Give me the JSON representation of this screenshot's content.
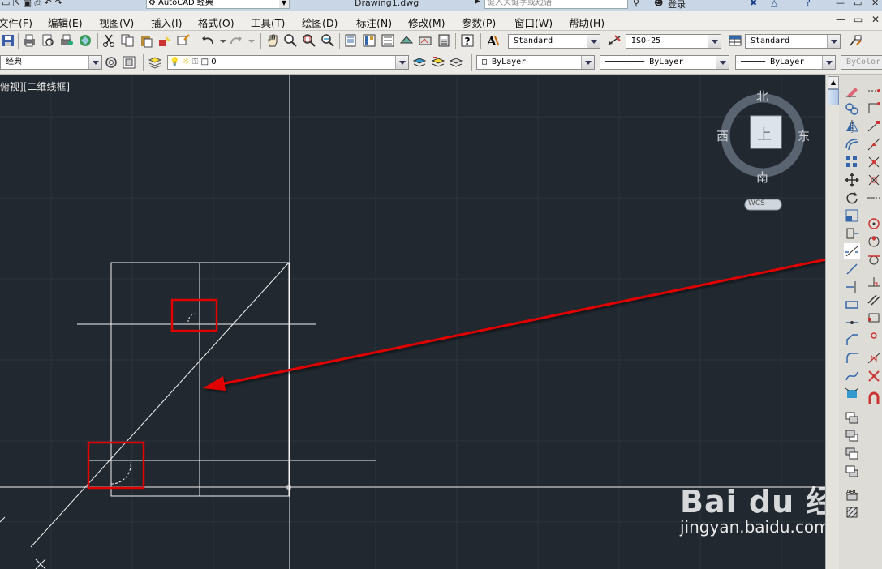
{
  "titlebar": {
    "workspace": "AutoCAD 经典",
    "filename": "Drawing1.dwg",
    "search_placeholder": "键入关键字或短语",
    "login": "登录"
  },
  "menu": {
    "items": [
      "文件(F)",
      "编辑(E)",
      "视图(V)",
      "插入(I)",
      "格式(O)",
      "工具(T)",
      "绘图(D)",
      "标注(N)",
      "修改(M)",
      "参数(P)",
      "窗口(W)",
      "帮助(H)"
    ]
  },
  "styles": {
    "text_style": "Standard",
    "dim_style": "ISO-25",
    "table_style": "Standard"
  },
  "layers": {
    "workspace": "经典",
    "current_layer": "0",
    "color": "ByLayer",
    "linetype": "ByLayer",
    "lineweight": "ByLayer",
    "plotstyle": "ByColor"
  },
  "viewport": {
    "label": "俯视][二维线框]"
  },
  "viewcube": {
    "north": "北",
    "south": "南",
    "east": "东",
    "west": "西",
    "face": "上",
    "ucs": "WCS"
  },
  "watermark": {
    "brand": "Bai du 经验",
    "url": "jingyan.baidu.com"
  },
  "colors": {
    "canvas": "#212830",
    "highlight": "#e00000",
    "line": "#ffffff"
  }
}
